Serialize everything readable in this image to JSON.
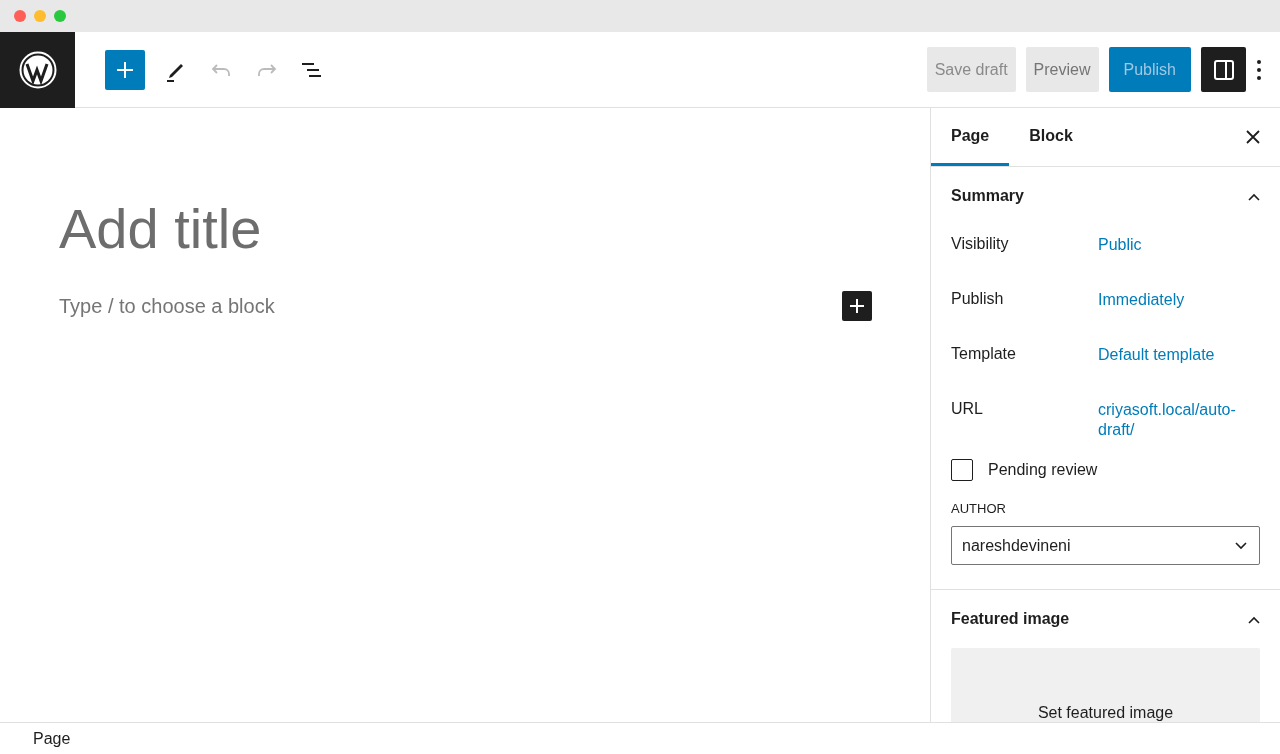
{
  "header": {
    "buttons": [
      {
        "label": "Save draft",
        "kind": "secondary",
        "disabled": true
      },
      {
        "label": "Preview",
        "kind": "secondary",
        "disabled": false
      },
      {
        "label": "Publish",
        "kind": "primary",
        "disabled": true
      }
    ],
    "settings_pressed": true
  },
  "editor": {
    "title_placeholder": "Add title",
    "block_placeholder": "Type / to choose a block"
  },
  "sidebar": {
    "tabs": [
      {
        "label": "Page",
        "selected": true
      },
      {
        "label": "Block",
        "selected": false
      }
    ],
    "summary": {
      "title": "Summary",
      "expanded": true,
      "rows": [
        {
          "label": "Visibility",
          "value": "Public"
        },
        {
          "label": "Publish",
          "value": "Immediately"
        },
        {
          "label": "Template",
          "value": "Default template"
        },
        {
          "label": "URL",
          "value": "criyasoft.local/auto-draft/"
        }
      ],
      "pending_review": {
        "label": "Pending review",
        "checked": false
      },
      "author": {
        "label": "AUTHOR",
        "value": "nareshdevineni"
      }
    },
    "featured": {
      "title": "Featured image",
      "expanded": true,
      "button": "Set featured image"
    }
  },
  "status_bar": {
    "breadcrumb": "Page"
  }
}
